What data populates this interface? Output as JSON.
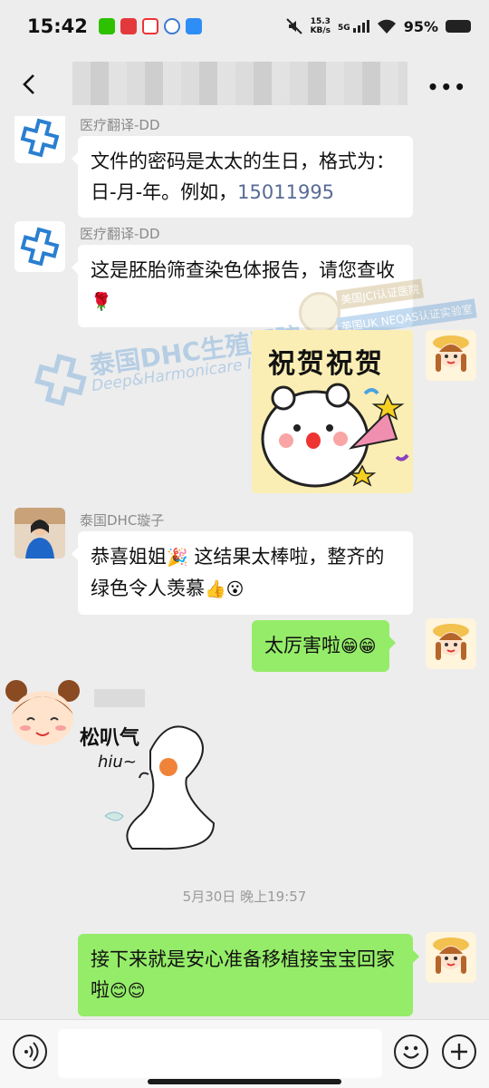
{
  "status_bar": {
    "time": "15:42",
    "net_speed_value": "15.3",
    "net_speed_unit": "KB/s",
    "network": "5G",
    "battery": "95%"
  },
  "nav": {
    "back_icon": "chevron-left-icon",
    "more_label": "•••"
  },
  "messages": [
    {
      "sender": "医疗翻译-DD",
      "text_a": "文件的密码是太太的生日，格式为：日-月-年。例如，",
      "text_link": "15011995"
    },
    {
      "sender": "医疗翻译-DD",
      "text": "这是胚胎筛查染色体报告，请您查收",
      "emoji": "🌹"
    },
    {
      "sticker_text": "祝贺祝贺"
    },
    {
      "sender": "泰国DHC璇子",
      "text_a": "恭喜姐姐",
      "emoji_a": "🎉",
      "text_b": " 这结果太棒啦，整齐的绿色令人羡慕",
      "emoji_b": "👍😮"
    },
    {
      "text": "太厉害啦",
      "emoji": "😁😁"
    },
    {
      "sticker_text_1": "松叭气",
      "sticker_text_2": "hiu~"
    },
    {
      "text": "接下来就是安心准备移植接宝宝回家啦",
      "emoji": "😊😊"
    }
  ],
  "time_divider": "5月30日 晚上19:57",
  "watermark": {
    "title": "泰国DHC生殖医院",
    "subtitle": "Deep&Harmonicare IVF Center",
    "badge_1": "美国JCI认证医院",
    "badge_2": "英国UK NEQAS认证实验室",
    "seal": "UK NEQAS"
  },
  "colors": {
    "green_bubble": "#95ec69",
    "link": "#576b95",
    "background": "#ededed"
  }
}
